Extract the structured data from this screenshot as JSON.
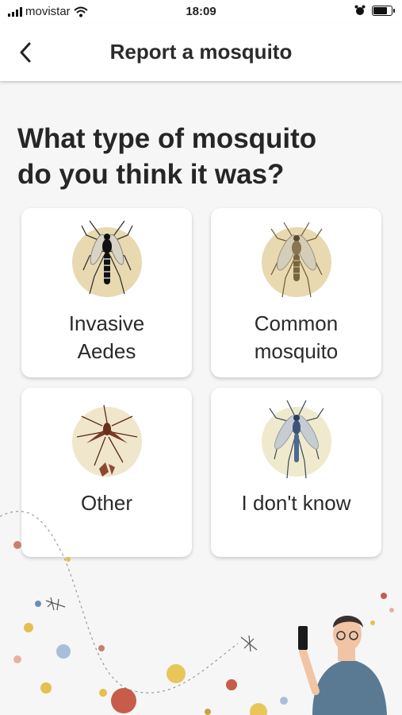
{
  "status_bar": {
    "carrier": "movistar",
    "time": "18:09",
    "battery_level": 0.8,
    "icons": [
      "signal-icon",
      "wifi-icon",
      "alarm-icon",
      "battery-icon"
    ]
  },
  "header": {
    "title": "Report a mosquito",
    "back_icon": "chevron-left-icon"
  },
  "question": {
    "line1": "What type of mosquito",
    "line2": "do you think it was?"
  },
  "options": [
    {
      "line1": "Invasive",
      "line2": "Aedes",
      "icon": "tiger-mosquito-icon",
      "disc_color": "#e8d9b0"
    },
    {
      "line1": "Common",
      "line2": "mosquito",
      "icon": "common-mosquito-icon",
      "disc_color": "#e8d9b0"
    },
    {
      "line1": "Other",
      "line2": "",
      "icon": "other-mosquito-icon",
      "disc_color": "#efe6cc"
    },
    {
      "line1": "I don't know",
      "line2": "",
      "icon": "unknown-mosquito-icon",
      "disc_color": "#efeacd"
    }
  ],
  "colors": {
    "background": "#f6f6f6",
    "card": "#ffffff",
    "text": "#262626"
  }
}
